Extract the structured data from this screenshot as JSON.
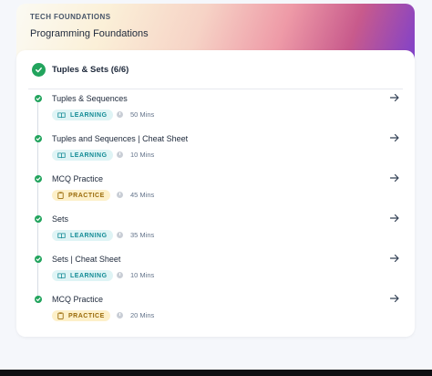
{
  "header": {
    "subtitle": "TECH FOUNDATIONS",
    "title": "Programming Foundations"
  },
  "section": {
    "title": "Tuples & Sets (6/6)"
  },
  "items": [
    {
      "title": "Tuples & Sequences",
      "badge": "LEARNING",
      "duration": "50 Mins"
    },
    {
      "title": "Tuples and Sequences | Cheat Sheet",
      "badge": "LEARNING",
      "duration": "10 Mins"
    },
    {
      "title": "MCQ Practice",
      "badge": "PRACTICE",
      "duration": "45 Mins"
    },
    {
      "title": "Sets",
      "badge": "LEARNING",
      "duration": "35 Mins"
    },
    {
      "title": "Sets | Cheat Sheet",
      "badge": "LEARNING",
      "duration": "10 Mins"
    },
    {
      "title": "MCQ Practice",
      "badge": "PRACTICE",
      "duration": "20 Mins"
    }
  ],
  "colors": {
    "complete": "#22a45d",
    "learning": "#148c96",
    "practice": "#9a6b0a"
  }
}
